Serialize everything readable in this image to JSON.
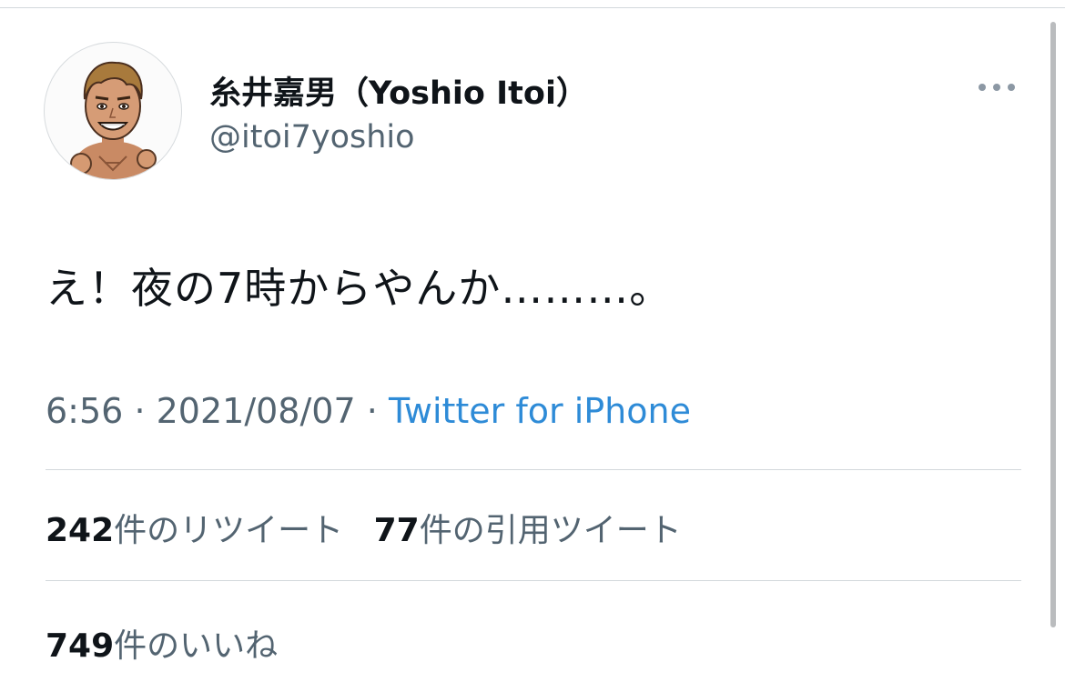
{
  "user": {
    "display_name": "糸井嘉男（Yoshio Itoi）",
    "handle": "@itoi7yoshio"
  },
  "more_icon": "more-horizontal-icon",
  "tweet": {
    "text": "え！夜の7時からやんか………。"
  },
  "meta": {
    "time": "6:56",
    "separator": "·",
    "date": "2021/08/07",
    "source": "Twitter for iPhone"
  },
  "stats": {
    "retweets": {
      "count": "242",
      "label": "件のリツイート"
    },
    "quotes": {
      "count": "77",
      "label": "件の引用ツイート"
    },
    "likes": {
      "count": "749",
      "label": "件のいいね"
    }
  },
  "colors": {
    "primary_text": "#0f1419",
    "secondary_text": "#536471",
    "link": "#2e8bd7",
    "divider": "#d3d8dc"
  }
}
